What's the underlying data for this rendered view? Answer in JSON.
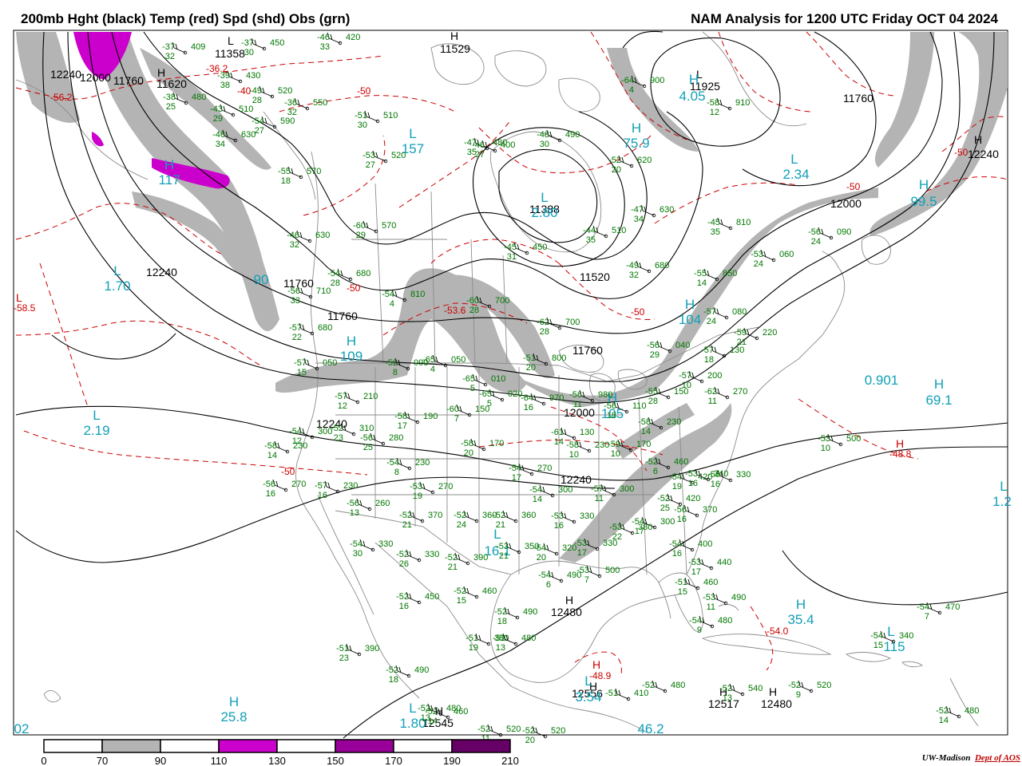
{
  "header": {
    "left_title": "200mb Hght (black) Temp (red) Spd (shd) Obs (grn)",
    "right_title": "NAM Analysis for 1200 UTC Friday  OCT 04 2024"
  },
  "colors": {
    "height_contours": "#000000",
    "temperature_contours": "#cc0000",
    "wind_shading": [
      "#ffffff",
      "#b4b4b4",
      "#ffffff",
      "#cc00cc",
      "#ffffff",
      "#990099",
      "#ffffff",
      "#660066"
    ],
    "observations": "#007700",
    "speed_centers": "#11a0b8",
    "geography": "#8c8c8c"
  },
  "colorbar": {
    "ticks": [
      "0",
      "70",
      "90",
      "110",
      "130",
      "150",
      "170",
      "190",
      "210"
    ]
  },
  "credit": {
    "institution": "UW-Madison",
    "department": "Dept of AOS"
  },
  "height_labels": [
    "11358",
    "11529",
    "12240",
    "12000",
    "11760",
    "11620",
    "11925",
    "11760",
    "12240",
    "12000",
    "11388",
    "11520",
    "12240",
    "11760",
    "11760",
    "11760",
    "12000",
    "12240",
    "12240",
    "12480",
    "12556",
    "12545",
    "12517",
    "12480"
  ],
  "height_centers": [
    "L",
    "H",
    "L",
    "H",
    "H",
    "H",
    "H",
    "H",
    "H",
    "H"
  ],
  "speed_centers": [
    {
      "letter": "H",
      "value": "117"
    },
    {
      "letter": "L",
      "value": "1.70"
    },
    {
      "letter": "",
      "value": "90"
    },
    {
      "letter": "H",
      "value": "109"
    },
    {
      "letter": "L",
      "value": "2.19"
    },
    {
      "letter": "H",
      "value": "25.8"
    },
    {
      "letter": "L",
      "value": "1.80"
    },
    {
      "letter": "L",
      "value": "157"
    },
    {
      "letter": "L",
      "value": "2.80"
    },
    {
      "letter": "H",
      "value": "4.05"
    },
    {
      "letter": "H",
      "value": "75.9"
    },
    {
      "letter": "L",
      "value": "2.34"
    },
    {
      "letter": "H",
      "value": "99.5"
    },
    {
      "letter": "H",
      "value": "104"
    },
    {
      "letter": "H",
      "value": "105"
    },
    {
      "letter": "",
      "value": "0.901"
    },
    {
      "letter": "H",
      "value": "69.1"
    },
    {
      "letter": "L",
      "value": "16.1"
    },
    {
      "letter": "H",
      "value": "35.4"
    },
    {
      "letter": "L",
      "value": "115"
    },
    {
      "letter": "L",
      "value": "3.54"
    },
    {
      "letter": "L",
      "value": "1.2"
    },
    {
      "letter": "",
      "value": "02"
    },
    {
      "letter": "",
      "value": "46.2"
    }
  ],
  "temperature_labels": [
    "-56.2",
    "-36.2",
    "-40",
    "-50",
    "-50",
    "-53.6",
    "-50",
    "-50",
    "-50",
    "-58.5",
    "-50",
    "-48.8",
    "-54.0",
    "-48.9"
  ],
  "temperature_centers": [
    "L",
    "H",
    "H"
  ],
  "observations": [
    {
      "t": "-37",
      "h": "409",
      "d": "32"
    },
    {
      "t": "-37",
      "h": "450",
      "d": "30"
    },
    {
      "t": "-46",
      "h": "420",
      "d": "33"
    },
    {
      "t": "-39",
      "h": "430",
      "d": "38"
    },
    {
      "t": "-38",
      "h": "480",
      "d": "25"
    },
    {
      "t": "-49",
      "h": "520",
      "d": "28"
    },
    {
      "t": "-43",
      "h": "510",
      "d": "29"
    },
    {
      "t": "-36",
      "h": "550",
      "d": "32"
    },
    {
      "t": "-54",
      "h": "590",
      "d": "27"
    },
    {
      "t": "-46",
      "h": "630",
      "d": "34"
    },
    {
      "t": "-51",
      "h": "510",
      "d": "30"
    },
    {
      "t": "-53",
      "h": "520",
      "d": "27"
    },
    {
      "t": "-47",
      "h": "480",
      "d": "35"
    },
    {
      "t": "-46",
      "h": "400",
      "d": "27"
    },
    {
      "t": "-48",
      "h": "490",
      "d": "30"
    },
    {
      "t": "-52",
      "h": "620",
      "d": "20"
    },
    {
      "t": "-55",
      "h": "570",
      "d": "18"
    },
    {
      "t": "-60",
      "h": "570",
      "d": "29"
    },
    {
      "t": "-46",
      "h": "630",
      "d": "32"
    },
    {
      "t": "-45",
      "h": "450",
      "d": "31"
    },
    {
      "t": "-44",
      "h": "510",
      "d": "35"
    },
    {
      "t": "-47",
      "h": "630",
      "d": "34"
    },
    {
      "t": "-64",
      "h": "900",
      "d": "4"
    },
    {
      "t": "-58",
      "h": "910",
      "d": "12"
    },
    {
      "t": "-45",
      "h": "810",
      "d": "35"
    },
    {
      "t": "-56",
      "h": "090",
      "d": "24"
    },
    {
      "t": "-53",
      "h": "060",
      "d": "24"
    },
    {
      "t": "-49",
      "h": "680",
      "d": "32"
    },
    {
      "t": "-55",
      "h": "850",
      "d": "14"
    },
    {
      "t": "-54",
      "h": "680",
      "d": "28"
    },
    {
      "t": "-56",
      "h": "710",
      "d": "33"
    },
    {
      "t": "-54",
      "h": "810",
      "d": "4"
    },
    {
      "t": "-60",
      "h": "700",
      "d": "28"
    },
    {
      "t": "-62",
      "h": "700",
      "d": "28"
    },
    {
      "t": "-57",
      "h": "680",
      "d": "22"
    },
    {
      "t": "-57",
      "h": "050",
      "d": "15"
    },
    {
      "t": "-52",
      "h": "090",
      "d": "8"
    },
    {
      "t": "-65",
      "h": "050",
      "d": "4"
    },
    {
      "t": "-51",
      "h": "800",
      "d": "20"
    },
    {
      "t": "-57",
      "h": "080",
      "d": "24"
    },
    {
      "t": "-59",
      "h": "220",
      "d": "21"
    },
    {
      "t": "-56",
      "h": "040",
      "d": "29"
    },
    {
      "t": "-57",
      "h": "130",
      "d": "18"
    },
    {
      "t": "-57",
      "h": "200",
      "d": "10"
    },
    {
      "t": "-62",
      "h": "270",
      "d": "11"
    },
    {
      "t": "-55",
      "h": "150",
      "d": "28"
    },
    {
      "t": "-65",
      "h": "010",
      "d": "5"
    },
    {
      "t": "-65",
      "h": "020",
      "d": "5"
    },
    {
      "t": "-64",
      "h": "970",
      "d": "16"
    },
    {
      "t": "-56",
      "h": "980",
      "d": "11"
    },
    {
      "t": "-56",
      "h": "110",
      "d": "18"
    },
    {
      "t": "-58",
      "h": "230",
      "d": "14"
    },
    {
      "t": "-58",
      "h": "170",
      "d": "20"
    },
    {
      "t": "-58",
      "h": "190",
      "d": "17"
    },
    {
      "t": "-57",
      "h": "210",
      "d": "12"
    },
    {
      "t": "-60",
      "h": "150",
      "d": "7"
    },
    {
      "t": "-61",
      "h": "130",
      "d": "14"
    },
    {
      "t": "-58",
      "h": "230",
      "d": "10"
    },
    {
      "t": "-59",
      "h": "170",
      "d": "10"
    },
    {
      "t": "-52",
      "h": "460",
      "d": "6"
    },
    {
      "t": "-54",
      "h": "230",
      "d": "8"
    },
    {
      "t": "-58",
      "h": "230",
      "d": "14"
    },
    {
      "t": "-54",
      "h": "300",
      "d": "12"
    },
    {
      "t": "-52",
      "h": "310",
      "d": "23"
    },
    {
      "t": "-56",
      "h": "280",
      "d": "25"
    },
    {
      "t": "-53",
      "h": "270",
      "d": "19"
    },
    {
      "t": "-54",
      "h": "270",
      "d": "17"
    },
    {
      "t": "-54",
      "h": "300",
      "d": "14"
    },
    {
      "t": "-56",
      "h": "270",
      "d": "16"
    },
    {
      "t": "-57",
      "h": "230",
      "d": "16"
    },
    {
      "t": "-56",
      "h": "260",
      "d": "13"
    },
    {
      "t": "-52",
      "h": "370",
      "d": "21"
    },
    {
      "t": "-52",
      "h": "360",
      "d": "24"
    },
    {
      "t": "-52",
      "h": "360",
      "d": "21"
    },
    {
      "t": "-53",
      "h": "330",
      "d": "16"
    },
    {
      "t": "-57",
      "h": "300",
      "d": "11"
    },
    {
      "t": "-54",
      "h": "300",
      "d": "17"
    },
    {
      "t": "-54",
      "h": "330",
      "d": "30"
    },
    {
      "t": "-52",
      "h": "330",
      "d": "26"
    },
    {
      "t": "-52",
      "h": "390",
      "d": "21"
    },
    {
      "t": "-53",
      "h": "350",
      "d": "21"
    },
    {
      "t": "-54",
      "h": "320",
      "d": "20"
    },
    {
      "t": "-53",
      "h": "330",
      "d": "17"
    },
    {
      "t": "-53",
      "h": "380",
      "d": "22"
    },
    {
      "t": "-52",
      "h": "420",
      "d": "25"
    },
    {
      "t": "-54",
      "h": "420",
      "d": "19"
    },
    {
      "t": "-53",
      "h": "340",
      "d": "16"
    },
    {
      "t": "-56",
      "h": "330",
      "d": "16"
    },
    {
      "t": "-56",
      "h": "370",
      "d": "16"
    },
    {
      "t": "-54",
      "h": "400",
      "d": "16"
    },
    {
      "t": "-53",
      "h": "440",
      "d": "17"
    },
    {
      "t": "-51",
      "h": "460",
      "d": "15"
    },
    {
      "t": "-53",
      "h": "490",
      "d": "11"
    },
    {
      "t": "-54",
      "h": "480",
      "d": "9"
    },
    {
      "t": "-54",
      "h": "490",
      "d": "6"
    },
    {
      "t": "-53",
      "h": "500",
      "d": "7"
    },
    {
      "t": "-52",
      "h": "450",
      "d": "16"
    },
    {
      "t": "-52",
      "h": "460",
      "d": "15"
    },
    {
      "t": "-51",
      "h": "390",
      "d": "23"
    },
    {
      "t": "-51",
      "h": "380",
      "d": "19"
    },
    {
      "t": "-52",
      "h": "480",
      "d": "13"
    },
    {
      "t": "-52",
      "h": "490",
      "d": "18"
    },
    {
      "t": "-52",
      "h": "490",
      "d": "18"
    },
    {
      "t": "-52",
      "h": "480",
      "d": "13"
    },
    {
      "t": "-52",
      "h": "520",
      "d": "11"
    },
    {
      "t": "-52",
      "h": "520",
      "d": "20"
    },
    {
      "t": "-51",
      "h": "410",
      "d": ""
    },
    {
      "t": "-52",
      "h": "480",
      "d": ""
    },
    {
      "t": "-52",
      "h": "540",
      "d": "13"
    },
    {
      "t": "-52",
      "h": "520",
      "d": "9"
    },
    {
      "t": "-53",
      "h": "500",
      "d": "10"
    },
    {
      "t": "-54",
      "h": "470",
      "d": "7"
    },
    {
      "t": "-54",
      "h": "340",
      "d": "15"
    },
    {
      "t": "-52",
      "h": "480",
      "d": "14"
    },
    {
      "t": "-52",
      "h": "460",
      "d": "14"
    },
    {
      "t": "-53",
      "h": "460",
      "d": "8"
    },
    {
      "t": "-52",
      "h": "470",
      "d": "17"
    }
  ]
}
